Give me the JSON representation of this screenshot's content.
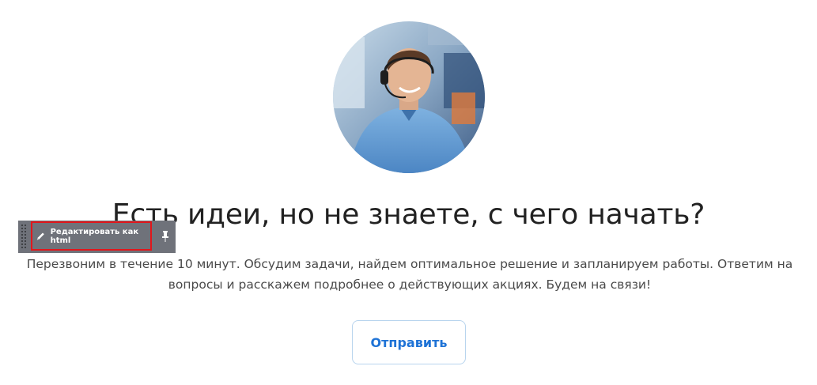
{
  "hero": {
    "avatar_alt": "support-operator-photo"
  },
  "title": "Есть идеи, но не знаете, с чего начать?",
  "description": "Перезвоним в течение 10 минут. Обсудим задачи, найдем оптимальное решение и запланируем работы. Ответим на вопросы и расскажем подробнее о действующих акциях. Будем на связи!",
  "send_button": "Отправить",
  "editor_toolbar": {
    "edit_html_label": "Редактировать как html",
    "icons": [
      "drag-handle-icon",
      "pencil-icon",
      "pin-icon"
    ]
  },
  "colors": {
    "button_text": "#1f73d6",
    "button_border": "#b8d4ee",
    "toolbar_bg": "#6f727a",
    "highlight": "#e2161b"
  }
}
